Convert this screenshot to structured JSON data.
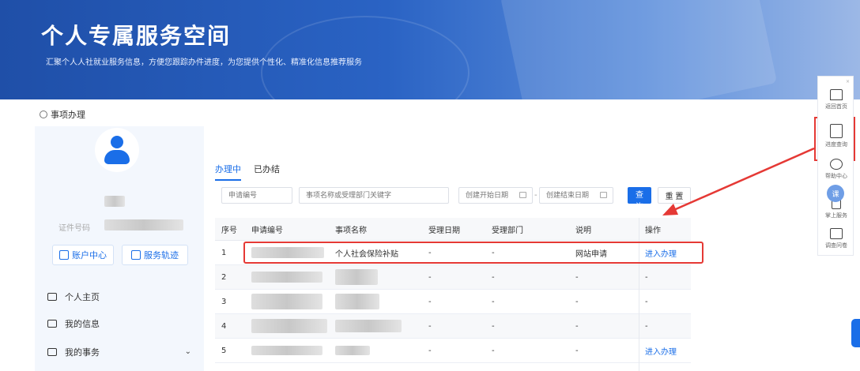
{
  "banner": {
    "title": "个人专属服务空间",
    "subtitle": "汇聚个人人社就业服务信息，方便您跟踪办件进度，为您提供个性化、精准化信息推荐服务"
  },
  "breadcrumb": {
    "label": "事项办理"
  },
  "profile": {
    "id_label": "证件号码",
    "account_button": "账户中心",
    "track_button": "服务轨迹"
  },
  "nav": [
    {
      "label": "个人主页",
      "icon": "folder-icon"
    },
    {
      "label": "我的信息",
      "icon": "folder-icon"
    },
    {
      "label": "我的事务",
      "icon": "list-icon"
    }
  ],
  "tabs": [
    {
      "label": "办理中",
      "active": true
    },
    {
      "label": "已办结",
      "active": false
    }
  ],
  "filters": {
    "apply_no_placeholder": "申请编号",
    "keyword_placeholder": "事项名称或受理部门关键字",
    "start_date_placeholder": "创建开始日期",
    "end_date_placeholder": "创建结束日期",
    "range_separator": "-",
    "query_button": "查 询",
    "reset_button": "重 置"
  },
  "table": {
    "headers": [
      "序号",
      "申请编号",
      "事项名称",
      "受理日期",
      "受理部门",
      "说明",
      "操作"
    ],
    "rows": [
      {
        "index": "1",
        "name": "个人社会保险补贴",
        "date": "-",
        "dept": "-",
        "note": "网站申请",
        "action": "进入办理"
      },
      {
        "index": "2",
        "name": "",
        "date": "-",
        "dept": "-",
        "note": "-",
        "action": "-"
      },
      {
        "index": "3",
        "name": "",
        "date": "-",
        "dept": "-",
        "note": "-",
        "action": "-"
      },
      {
        "index": "4",
        "name": "",
        "date": "-",
        "dept": "-",
        "note": "-",
        "action": "-"
      },
      {
        "index": "5",
        "name": "",
        "date": "-",
        "dept": "-",
        "note": "-",
        "action": "进入办理"
      }
    ]
  },
  "sidebar": {
    "close": "×",
    "items": [
      {
        "label": "返回首页",
        "icon": "home-icon"
      },
      {
        "label": "进度查询",
        "icon": "progress-doc-icon"
      },
      {
        "label": "帮助中心",
        "icon": "headset-icon"
      },
      {
        "label": "掌上服务",
        "icon": "mobile-icon"
      },
      {
        "label": "调查问卷",
        "icon": "survey-icon"
      }
    ],
    "bubble": "课"
  },
  "colors": {
    "accent": "#1a6ee8",
    "highlight": "#e53935",
    "banner": "#2a63c4"
  }
}
